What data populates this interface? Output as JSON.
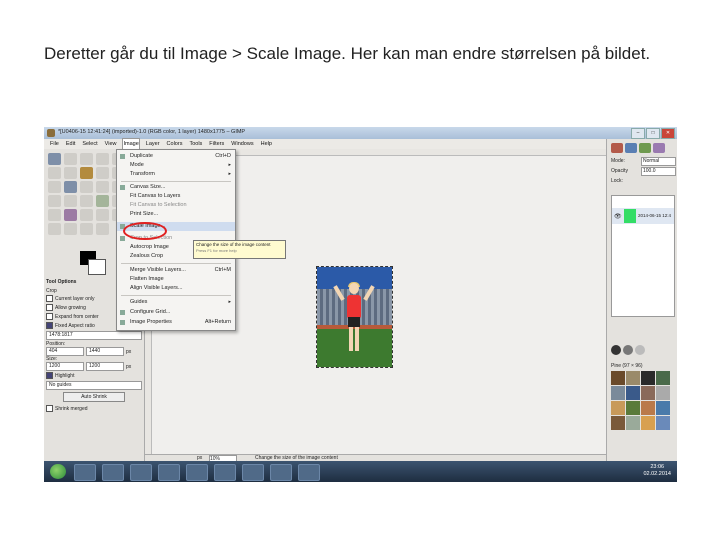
{
  "caption": "Deretter går du til Image > Scale Image. Her kan man endre størrelsen på bildet.",
  "gimp": {
    "window_title": "*[U0406-15 12:41:24] (imported)-1.0 (RGB color, 1 layer) 1480x1775 – GIMP",
    "menubar": [
      "File",
      "Edit",
      "Select",
      "View",
      "Image",
      "Layer",
      "Colors",
      "Tools",
      "Filters",
      "Windows",
      "Help"
    ],
    "window_buttons": [
      "–",
      "□",
      "✕"
    ],
    "image_menu": [
      {
        "label": "Duplicate",
        "shortcut": "Ctrl+D"
      },
      {
        "label": "Mode",
        "arrow": "▸"
      },
      {
        "label": "Transform",
        "arrow": "▸"
      },
      {
        "label": "Canvas Size..."
      },
      {
        "label": "Fit Canvas to Layers"
      },
      {
        "label": "Fit Canvas to Selection"
      },
      {
        "label": "Print Size..."
      },
      {
        "label": "Scale Image..."
      },
      {
        "label": "Crop to Selection"
      },
      {
        "label": "Autocrop Image"
      },
      {
        "label": "Zealous Crop"
      },
      {
        "label": "Merge Visible Layers...",
        "shortcut": "Ctrl+M"
      },
      {
        "label": "Flatten Image"
      },
      {
        "label": "Align Visible Layers..."
      },
      {
        "label": "Guides",
        "arrow": "▸"
      },
      {
        "label": "Configure Grid..."
      },
      {
        "label": "Image Properties",
        "shortcut": "Alt+Return"
      }
    ],
    "tooltip": {
      "line1": "Change the size of the image content",
      "line2": "Press F1 for more help"
    },
    "tool_options": {
      "header": "Tool Options",
      "crop": "Crop",
      "options": [
        "Current layer only",
        "Allow growing",
        "Expand from center"
      ],
      "fixed": "Fixed Aspect ratio",
      "ratio": "1478:1817",
      "position_label": "Position:",
      "pos_x": "404",
      "pos_y": "1440",
      "pos_unit": "px",
      "size_label": "Size:",
      "size_w": "1200",
      "size_h": "1200",
      "size_unit": "px",
      "highlight": "Highlight",
      "guides": "No guides",
      "auto_shrink": "Auto Shrink",
      "shrink_merged": "Shrink merged"
    },
    "status": {
      "unit": "px",
      "zoom": "10%",
      "message": "Change the size of the image content"
    },
    "layers_panel": {
      "mode_label": "Mode:",
      "mode": "Normal",
      "opacity_label": "Opacity",
      "opacity": "100.0",
      "lock_label": "Lock:",
      "layer_name": "2014-06-15 12:4"
    },
    "patterns": {
      "label": "Pine (97 × 96)",
      "filter": "Solid"
    },
    "taskbar_clock": {
      "time": "23:06",
      "date": "02.02.2014"
    }
  }
}
